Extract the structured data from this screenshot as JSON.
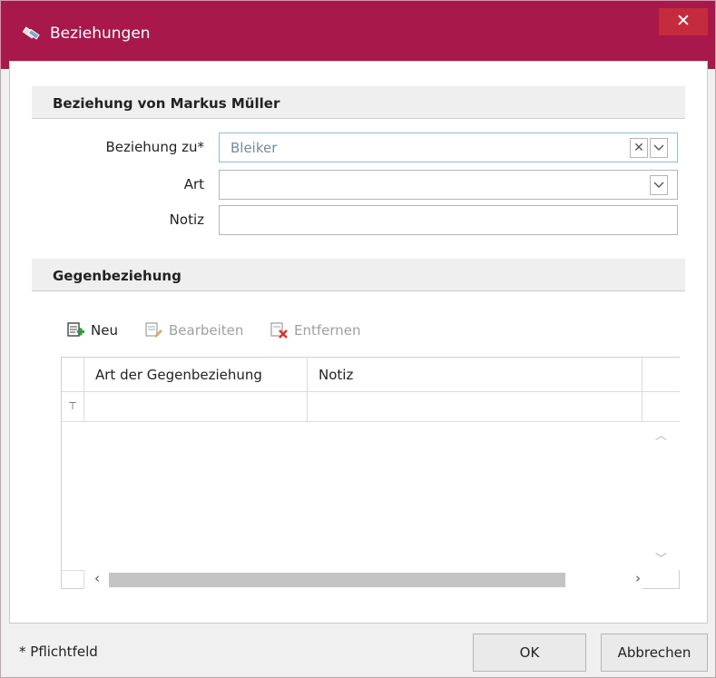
{
  "window": {
    "title": "Beziehungen",
    "close_glyph": "✕"
  },
  "section1": {
    "heading": "Beziehung von Markus Müller"
  },
  "form": {
    "beziehung_label": "Beziehung zu*",
    "beziehung_value": "Bleiker",
    "art_label": "Art",
    "art_value": "",
    "notiz_label": "Notiz",
    "notiz_value": ""
  },
  "section2": {
    "heading": "Gegenbeziehung"
  },
  "toolbar": {
    "new_label": "Neu",
    "edit_label": "Bearbeiten",
    "remove_label": "Entfernen"
  },
  "grid": {
    "columns": [
      "Art der Gegenbeziehung",
      "Notiz"
    ],
    "filter_glyph": "⊤",
    "scroll_up": "︿",
    "scroll_down": "﹀",
    "scroll_left": "‹",
    "scroll_right": "›"
  },
  "footer": {
    "required_note": "* Pflichtfeld",
    "ok_label": "OK",
    "cancel_label": "Abbrechen"
  },
  "colors": {
    "titlebar": "#a8184a",
    "close_button": "#c42b3c",
    "accent_green": "#2e9e3e",
    "accent_red": "#d9362b"
  }
}
